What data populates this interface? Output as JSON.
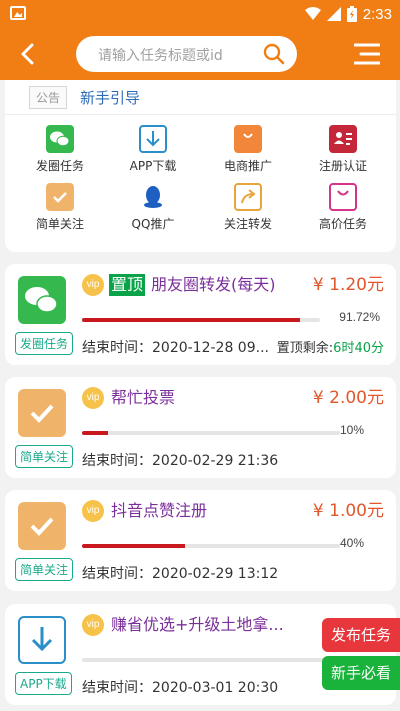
{
  "status_bar": {
    "time": "2:33"
  },
  "header": {
    "search_placeholder": "请输入任务标题或id"
  },
  "notice": {
    "tag": "公告",
    "link": "新手引导"
  },
  "categories": [
    {
      "label": "发圈任务",
      "icon": "wechat-icon"
    },
    {
      "label": "APP下载",
      "icon": "download-icon"
    },
    {
      "label": "电商推广",
      "icon": "shopping-bag-icon"
    },
    {
      "label": "注册认证",
      "icon": "register-icon"
    },
    {
      "label": "简单关注",
      "icon": "check-icon"
    },
    {
      "label": "QQ推广",
      "icon": "qq-icon"
    },
    {
      "label": "关注转发",
      "icon": "share-icon"
    },
    {
      "label": "高价任务",
      "icon": "gift-bag-icon"
    }
  ],
  "tasks": [
    {
      "vip": "vip",
      "top_badge": "置顶",
      "title": "朋友圈转发(每天)",
      "price": "¥ 1.20元",
      "progress": 91.72,
      "percent_label": "91.72%",
      "end_time": "结束时间：2020-12-28 09...",
      "top_remaining_label": "置顶剩余:",
      "top_remaining_value": "6时40分",
      "tag": "发圈任务",
      "icon": "wechat-icon"
    },
    {
      "vip": "vip",
      "title": "帮忙投票",
      "price": "¥ 2.00元",
      "progress": 10,
      "percent_label": "10%",
      "end_time": "结束时间：2020-02-29 21:36",
      "tag": "简单关注",
      "icon": "check-icon"
    },
    {
      "vip": "vip",
      "title": "抖音点赞注册",
      "price": "¥ 1.00元",
      "progress": 40,
      "percent_label": "40%",
      "end_time": "结束时间：2020-02-29 13:12",
      "tag": "简单关注",
      "icon": "check-icon"
    },
    {
      "vip": "vip",
      "title": "赚省优选+升级土地拿...",
      "price": "",
      "progress": 0,
      "percent_label": "",
      "end_time": "结束时间：2020-03-01 20:30",
      "tag": "APP下载",
      "icon": "download-icon"
    }
  ],
  "float_buttons": {
    "publish": "发布任务",
    "guide": "新手必看"
  },
  "colors": {
    "brand": "#f07e14",
    "price": "#e2572b",
    "title": "#7b2f9a",
    "progress": "#c9191f",
    "tag": "#19a98b",
    "publish": "#e8373c",
    "guide": "#19b23a"
  }
}
